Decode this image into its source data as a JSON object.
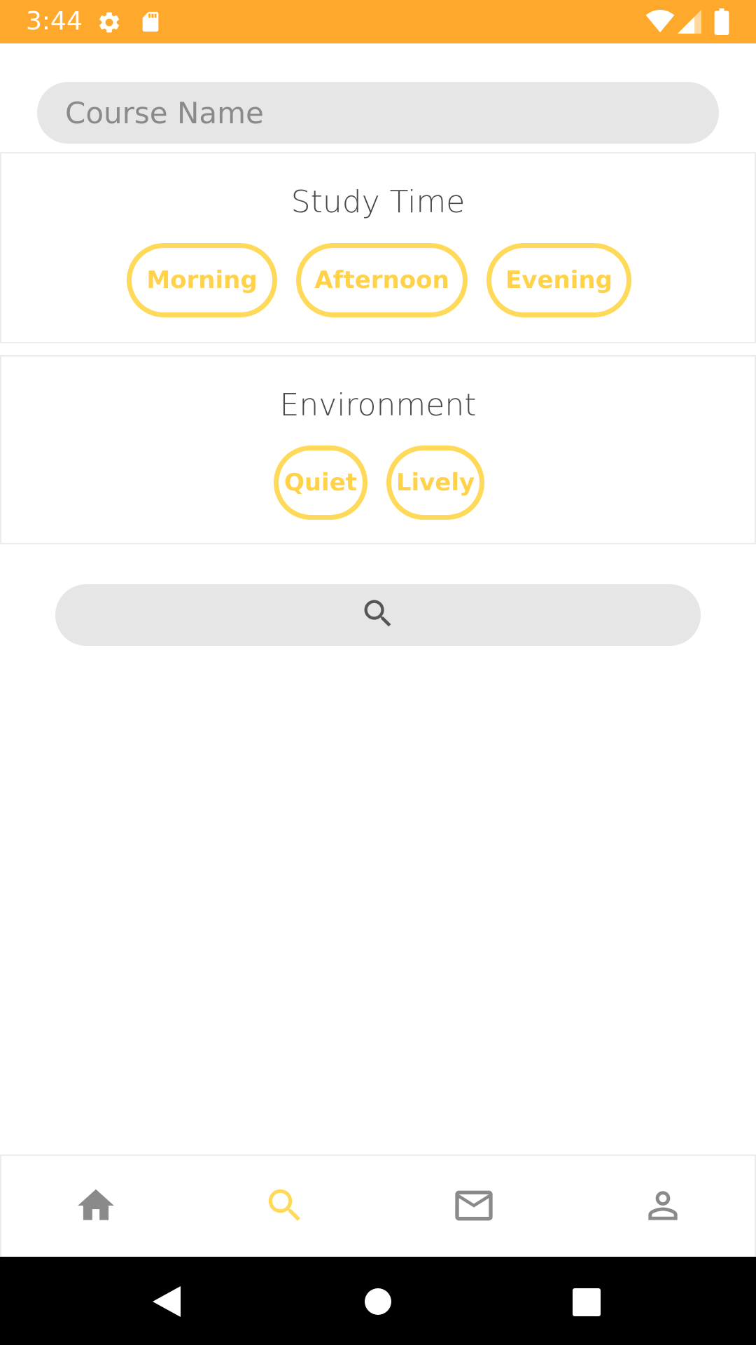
{
  "status_bar": {
    "time": "3:44",
    "background": "#FFA92C",
    "icons": [
      "settings-gear-icon",
      "sd-card-icon",
      "wifi-icon",
      "cell-signal-icon",
      "battery-icon"
    ]
  },
  "search_form": {
    "course_name_placeholder": "Course Name",
    "course_name_value": ""
  },
  "study_time": {
    "title": "Study Time",
    "options": [
      "Morning",
      "Afternoon",
      "Evening"
    ]
  },
  "environment": {
    "title": "Environment",
    "options": [
      "Quiet",
      "Lively"
    ]
  },
  "search_button": {
    "icon": "search-icon"
  },
  "bottom_nav": {
    "items": [
      {
        "icon": "home-icon",
        "active": false
      },
      {
        "icon": "search-icon",
        "active": true
      },
      {
        "icon": "mail-icon",
        "active": false
      },
      {
        "icon": "profile-icon",
        "active": false
      }
    ],
    "active_color": "#FFD95A",
    "inactive_color": "#8a8a8a"
  },
  "system_nav": {
    "buttons": [
      "back-icon",
      "home-circle-icon",
      "recents-icon"
    ]
  },
  "colors": {
    "accent": "#FFD95A",
    "status_bar": "#FFA92C",
    "input_background": "#E6E6E6"
  }
}
